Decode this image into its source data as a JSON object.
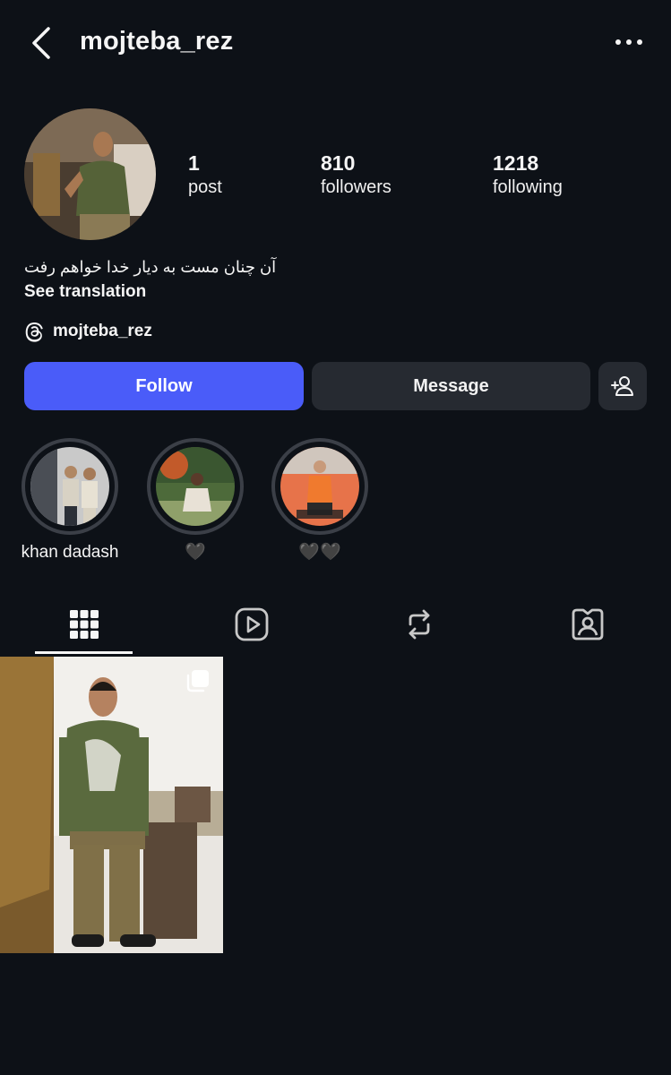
{
  "header": {
    "username": "mojteba_rez",
    "back_icon": "chevron-left-icon",
    "more_icon": "more-horizontal-icon"
  },
  "profile": {
    "avatar_icon": "profile-photo",
    "stats": [
      {
        "value": "1",
        "label": "post"
      },
      {
        "value": "810",
        "label": "followers"
      },
      {
        "value": "1218",
        "label": "following"
      }
    ],
    "bio": "آن چنان مست به دیار خدا خواهم رفت",
    "see_translation": "See translation",
    "threads_handle": "mojteba_rez",
    "threads_icon": "threads-icon"
  },
  "actions": {
    "follow": "Follow",
    "message": "Message",
    "add_user_icon": "add-person-icon",
    "follow_color": "#4a5cf9"
  },
  "highlights": [
    {
      "caption": "khan dadash"
    },
    {
      "caption": "🖤"
    },
    {
      "caption": "🖤🖤"
    }
  ],
  "tabs": [
    {
      "name": "grid",
      "icon": "grid-icon",
      "active": true
    },
    {
      "name": "reels",
      "icon": "reels-icon",
      "active": false
    },
    {
      "name": "reposts",
      "icon": "repost-icon",
      "active": false
    },
    {
      "name": "tagged",
      "icon": "tagged-icon",
      "active": false
    }
  ],
  "posts": [
    {
      "type": "carousel",
      "icon": "multiple-photos-icon"
    }
  ]
}
